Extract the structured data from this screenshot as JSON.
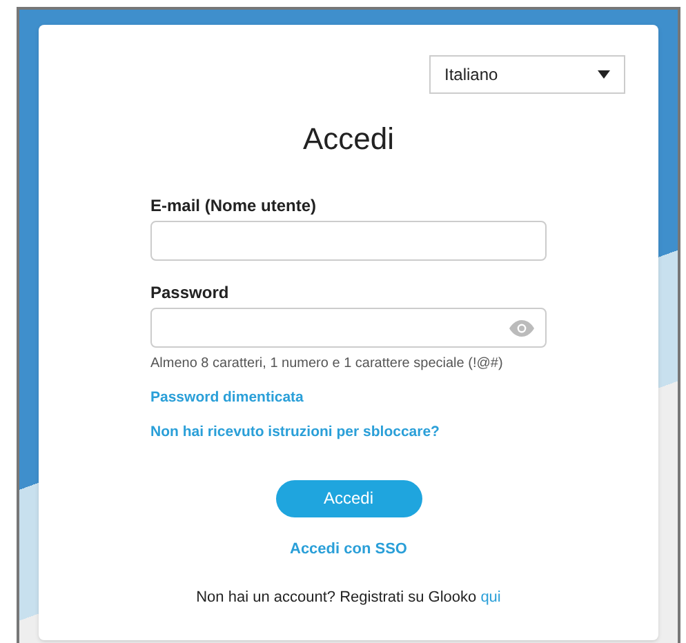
{
  "language_select": {
    "value": "Italiano"
  },
  "title": "Accedi",
  "fields": [
    {
      "kind": "text",
      "label": "E-mail (Nome utente)"
    },
    {
      "kind": "password",
      "label": "Password",
      "hint": "Almeno 8 caratteri, 1 numero e 1 carattere speciale (!@#)"
    }
  ],
  "links": [
    "Password dimenticata",
    "Non hai ricevuto istruzioni per sbloccare?"
  ],
  "submit_button": "Accedi",
  "sso_link": "Accedi con SSO",
  "signup": {
    "text": "Non hai un account? Registrati su Glooko",
    "link": "qui"
  }
}
